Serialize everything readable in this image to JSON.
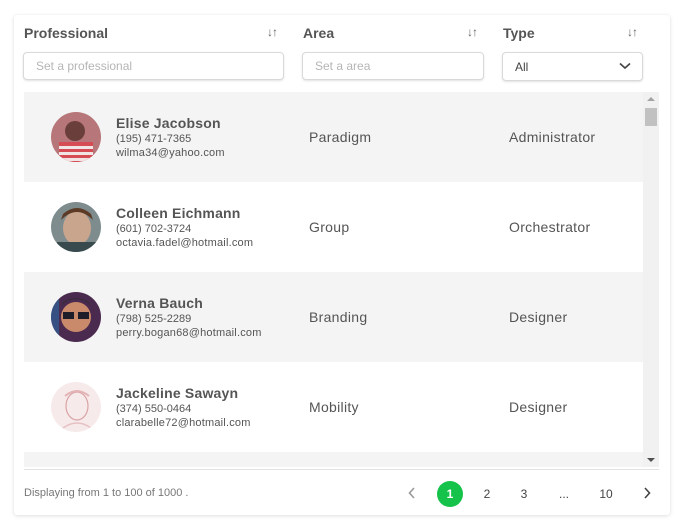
{
  "columns": {
    "professional": "Professional",
    "area": "Area",
    "type": "Type",
    "sort_glyph": "↓↑"
  },
  "filters": {
    "professional_placeholder": "Set a professional",
    "area_placeholder": "Set a area",
    "type_value": "All"
  },
  "rows": [
    {
      "name": "Elise Jacobson",
      "phone": "(195) 471-7365",
      "email": "wilma34@yahoo.com",
      "area": "Paradigm",
      "type": "Administrator"
    },
    {
      "name": "Colleen Eichmann",
      "phone": "(601) 702-3724",
      "email": "octavia.fadel@hotmail.com",
      "area": "Group",
      "type": "Orchestrator"
    },
    {
      "name": "Verna Bauch",
      "phone": "(798) 525-2289",
      "email": "perry.bogan68@hotmail.com",
      "area": "Branding",
      "type": "Designer"
    },
    {
      "name": "Jackeline Sawayn",
      "phone": "(374) 550-0464",
      "email": "clarabelle72@hotmail.com",
      "area": "Mobility",
      "type": "Designer"
    }
  ],
  "footer": {
    "summary": "Displaying from 1 to 100 of 1000 .",
    "pages": [
      "1",
      "2",
      "3",
      "...",
      "10"
    ],
    "active_page": "1"
  },
  "colors": {
    "accent": "#15c24a",
    "row_shade": "#f4f4f4"
  },
  "icons": {
    "sort": "sort-icon",
    "dropdown": "chevron-down-icon",
    "prev": "chevron-left-icon",
    "next": "chevron-right-icon"
  }
}
